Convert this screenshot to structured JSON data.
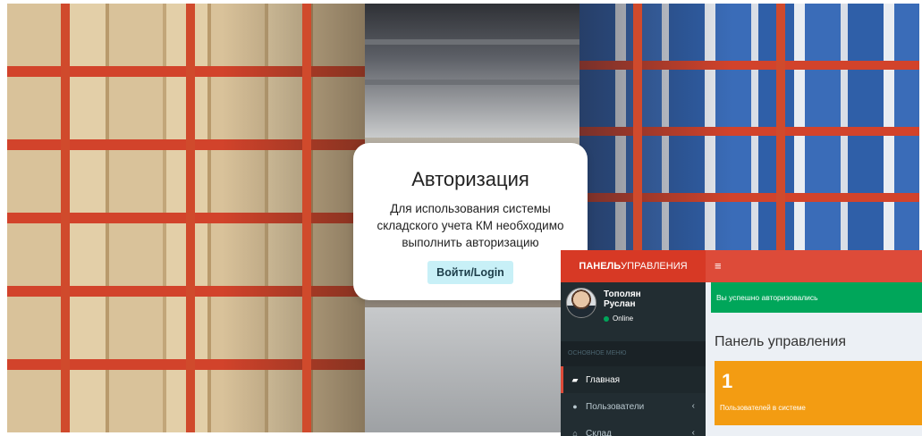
{
  "login": {
    "title": "Авторизация",
    "message": "Для использования системы складского учета КМ необходимо выполнить авторизацию",
    "button_label": "Войти/Login"
  },
  "panel": {
    "logo_bold": "ПАНЕЛЬ",
    "logo_rest": "УПРАВЛЕНИЯ",
    "menu_icon": "hamburger-icon",
    "user": {
      "name_line1": "Тополян",
      "name_line2": "Руслан",
      "status": "Online",
      "status_color": "#00a65a"
    },
    "menu_header": "ОСНОВНОЕ МЕНЮ",
    "menu_items": [
      {
        "label": "Главная",
        "icon": "dashboard-icon",
        "active": true
      },
      {
        "label": "Пользователи",
        "icon": "user-icon",
        "active": false
      },
      {
        "label": "Склад",
        "icon": "home-icon",
        "active": false
      }
    ],
    "alert": "Вы успешно авторизовались",
    "page_title": "Панель управления",
    "stat_box": {
      "value": "1",
      "label": "Пользователей в системе",
      "color": "#f39c12"
    },
    "colors": {
      "header": "#dd4b39",
      "sidebar": "#222d32",
      "success": "#00a65a"
    }
  }
}
